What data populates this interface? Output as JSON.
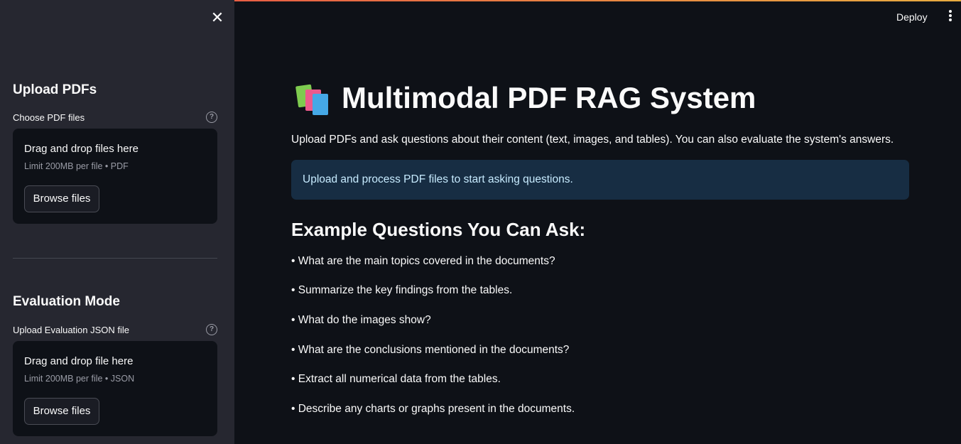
{
  "window": {
    "deploy_label": "Deploy"
  },
  "sidebar": {
    "close_icon": "close-icon",
    "upload_section": {
      "heading": "Upload PDFs",
      "label": "Choose PDF files",
      "help_icon": "?",
      "dropzone_title": "Drag and drop files here",
      "dropzone_limit": "Limit 200MB per file • PDF",
      "browse_label": "Browse files"
    },
    "evaluation_section": {
      "heading": "Evaluation Mode",
      "label": "Upload Evaluation JSON file",
      "help_icon": "?",
      "dropzone_title": "Drag and drop file here",
      "dropzone_limit": "Limit 200MB per file • JSON",
      "browse_label": "Browse files"
    }
  },
  "main": {
    "title_icon": "books-icon",
    "title": "Multimodal PDF RAG System",
    "subtitle": "Upload PDFs and ask questions about their content (text, images, and tables). You can also evaluate the system's answers.",
    "info_message": "Upload and process PDF files to start asking questions.",
    "examples_heading": "Example Questions You Can Ask:",
    "questions": [
      "• What are the main topics covered in the documents?",
      "• Summarize the key findings from the tables.",
      "• What do the images show?",
      "• What are the conclusions mentioned in the documents?",
      "• Extract all numerical data from the tables.",
      "• Describe any charts or graphs present in the documents."
    ]
  },
  "colors": {
    "background": "#0e1117",
    "sidebar": "#262730",
    "info_bg": "#172d43",
    "info_text": "#c7ebff"
  }
}
